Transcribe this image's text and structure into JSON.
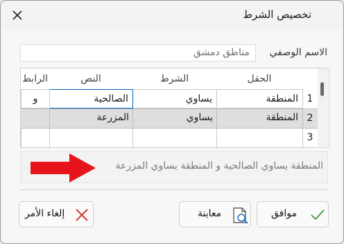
{
  "window": {
    "title": "تخصيص الشرط"
  },
  "description": {
    "label": "الاسم الوصفي",
    "value": "مناطق دمشق"
  },
  "grid": {
    "headers": {
      "field": "الحقل",
      "condition": "الشرط",
      "text": "النص",
      "link": "الرابط"
    },
    "rows": [
      {
        "num": "1",
        "field": "المنطقة",
        "condition": "يساوي",
        "text": "الصالحية",
        "link": "و"
      },
      {
        "num": "2",
        "field": "المنطقة",
        "condition": "يساوي",
        "text": "المزرعة",
        "link": ""
      },
      {
        "num": "3",
        "field": "",
        "condition": "",
        "text": "",
        "link": ""
      }
    ]
  },
  "summary": {
    "text": "المنطقة يساوي الصالحية و المنطقة يساوي المزرعة"
  },
  "buttons": {
    "ok": "موافق",
    "preview": "معاينة",
    "cancel": "إلغاء الأمر"
  },
  "colors": {
    "accent": "#0067c0",
    "arrow": "#e8141b",
    "selected_row": "#dedede",
    "ok_check": "#3a9a3a",
    "cancel_x": "#d43b3b"
  }
}
